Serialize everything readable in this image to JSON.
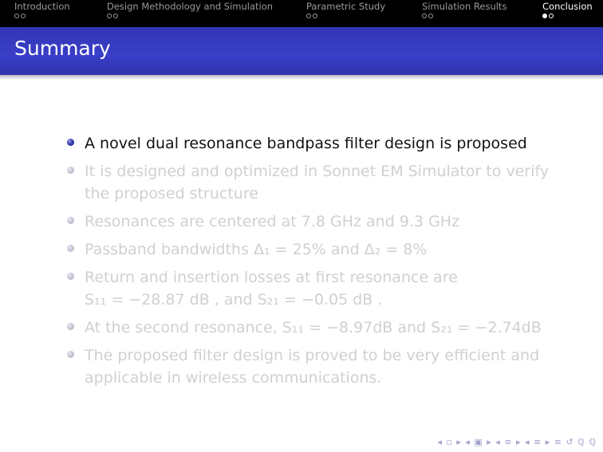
{
  "nav": {
    "sections": [
      {
        "title": "Introduction",
        "dots": [
          false,
          false
        ],
        "active": false
      },
      {
        "title": "Design Methodology and Simulation",
        "dots": [
          false,
          false
        ],
        "active": false
      },
      {
        "title": "Parametric Study",
        "dots": [
          false,
          false
        ],
        "active": false
      },
      {
        "title": "Simulation Results",
        "dots": [
          false,
          false
        ],
        "active": false
      },
      {
        "title": "Conclusion",
        "dots": [
          true,
          false
        ],
        "active": true
      }
    ]
  },
  "frame": {
    "title": "Summary"
  },
  "bullets": [
    {
      "text": "A novel dual resonance bandpass filter design is proposed",
      "current": true
    },
    {
      "text": "It is designed and optimized in Sonnet EM Simulator to verify\nthe proposed structure",
      "current": false
    },
    {
      "text": "Resonances are centered at 7.8 GHz and 9.3 GHz",
      "current": false
    },
    {
      "text": "Passband bandwidths Δ₁ = 25% and Δ₂ = 8%",
      "current": false
    },
    {
      "text": "Return and insertion losses at first resonance are\nS₁₁ = −28.87 dB , and S₂₁ = −0.05 dB .",
      "current": false
    },
    {
      "text": "At the second resonance, S₁₁ = −8.97dB and S₂₁ = −2.74dB",
      "current": false
    },
    {
      "text": "The proposed filter design is proved to be very efficient and\napplicable in wireless communications.",
      "current": false
    }
  ],
  "beamer_nav": {
    "symbols": "◂ ▫ ▸ ◂ ▣ ▸ ◂ ≡ ▸ ◂ ≡ ▸   ≡   ↺ ℚ ℚ"
  },
  "colors": {
    "header_bg": "#000000",
    "title_bar": "#3a3ec8",
    "active_text": "#111111",
    "inactive_text": "#d0d0d0",
    "bullet_ball": "#2a2e9e"
  }
}
